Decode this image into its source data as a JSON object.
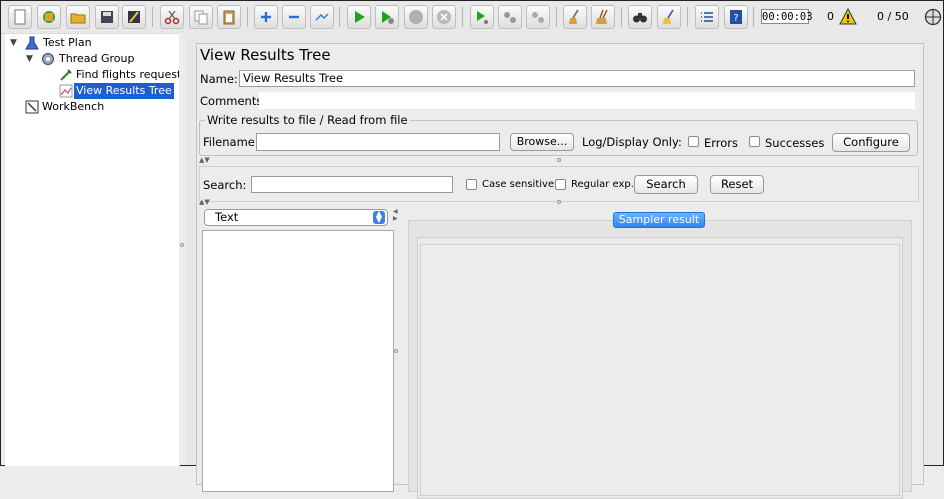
{
  "toolbar": {
    "timer": "00:00:03",
    "error_count": "0",
    "threads": "0 / 50"
  },
  "tree": {
    "test_plan": "Test Plan",
    "thread_group": "Thread Group",
    "sampler": "Find flights request",
    "listener": "View Results Tree",
    "workbench": "WorkBench"
  },
  "panel": {
    "title": "View Results Tree",
    "name_label": "Name:",
    "name_value": "View Results Tree",
    "comments_label": "Comments:",
    "write_legend": "Write results to file / Read from file",
    "filename_label": "Filename",
    "browse_label": "Browse...",
    "log_display_label": "Log/Display Only:",
    "errors_label": "Errors",
    "successes_label": "Successes",
    "configure_label": "Configure"
  },
  "search": {
    "label": "Search:",
    "case_sensitive": "Case sensitive",
    "regular_exp": "Regular exp.",
    "search_button": "Search",
    "reset_button": "Reset"
  },
  "results": {
    "renderer": "Text",
    "tab_label": "Sampler result"
  },
  "colors": {
    "selection": "#1b5fd1",
    "tab_blue": "#2c86f0"
  }
}
